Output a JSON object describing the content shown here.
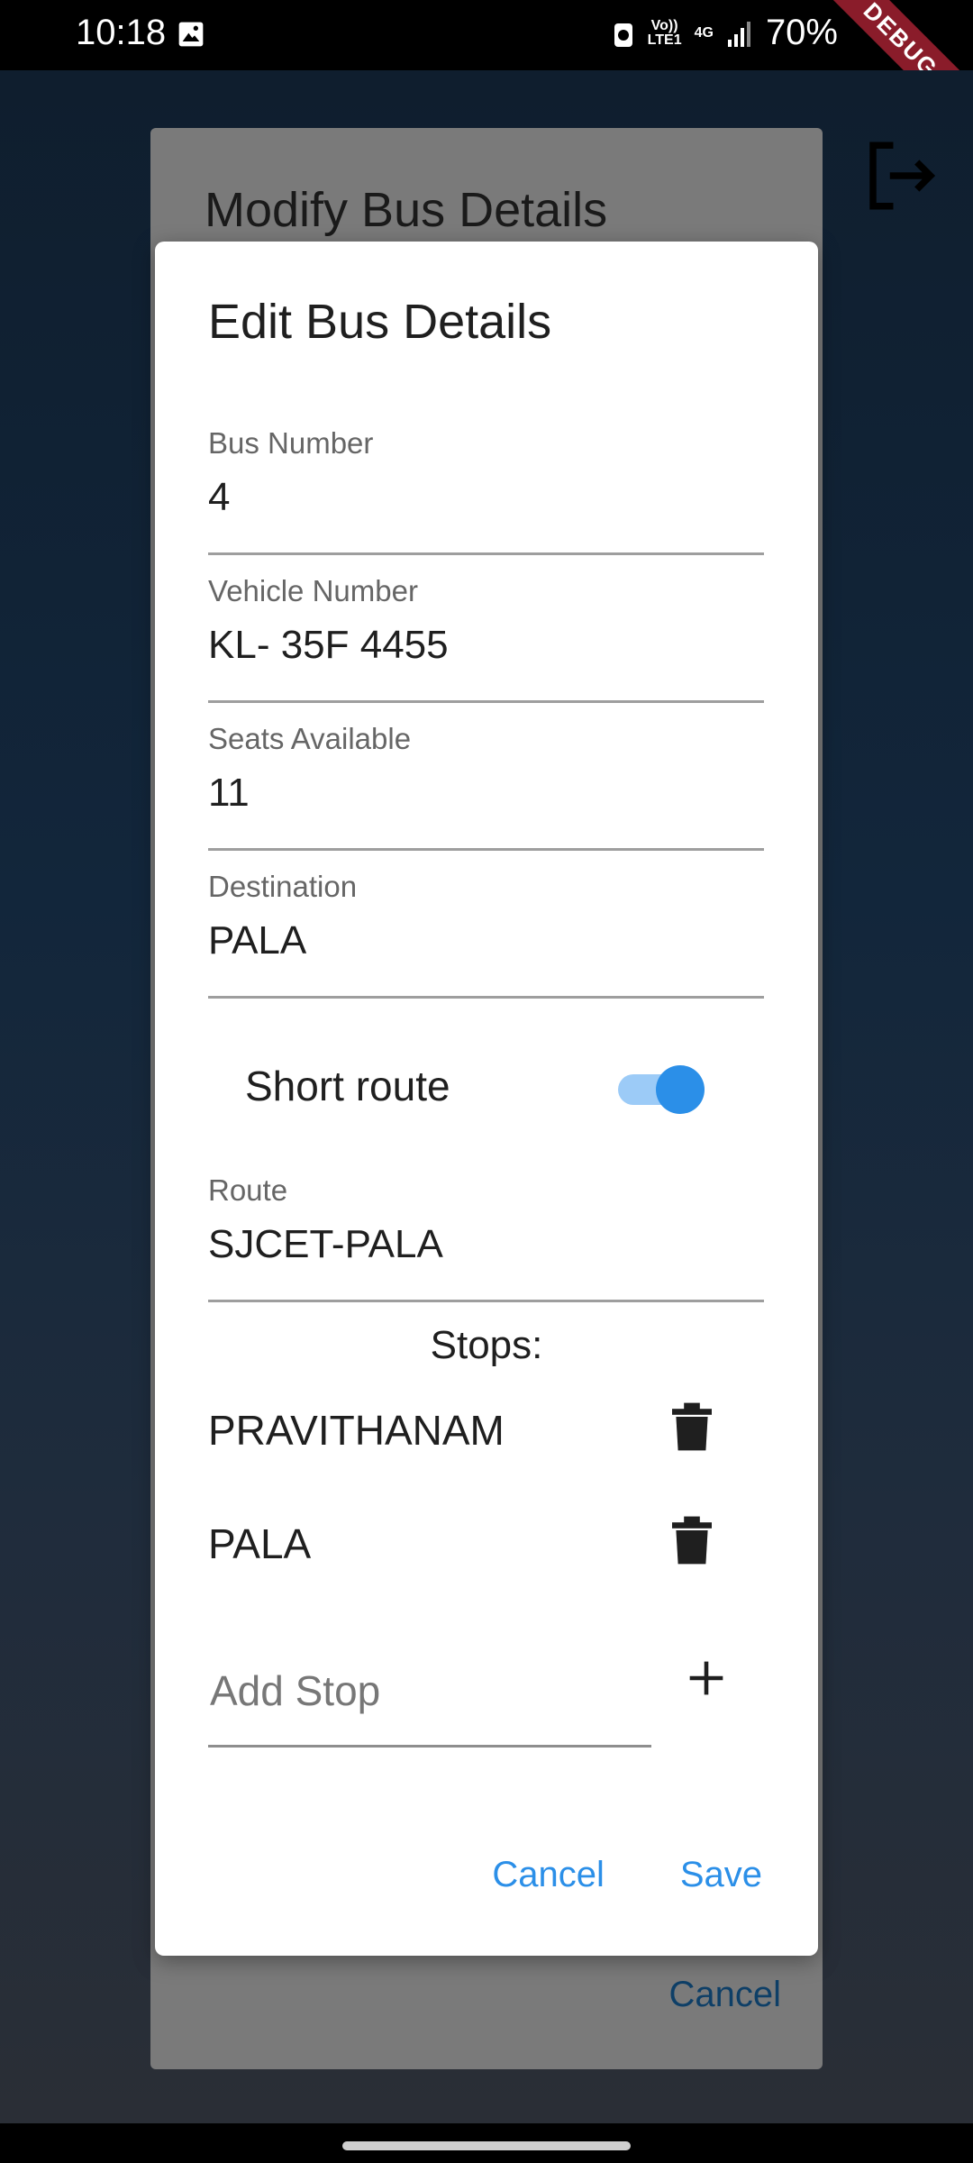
{
  "status_bar": {
    "time": "10:18",
    "volte_line1": "Vo))",
    "volte_line2": "LTE1",
    "network": "4G",
    "battery": "70%",
    "debug_label": "DEBUG"
  },
  "background": {
    "outer_dialog_title": "Modify Bus Details",
    "outer_cancel_label": "Cancel"
  },
  "dialog": {
    "title": "Edit Bus Details",
    "fields": [
      {
        "label": "Bus Number",
        "value": "4"
      },
      {
        "label": "Vehicle Number",
        "value": "KL- 35F 4455"
      },
      {
        "label": "Seats Available",
        "value": "11"
      },
      {
        "label": "Destination",
        "value": "PALA"
      }
    ],
    "short_route": {
      "label": "Short route",
      "enabled": true
    },
    "route": {
      "label": "Route",
      "value": "SJCET-PALA"
    },
    "stops_title": "Stops:",
    "stops": [
      {
        "name": "PRAVITHANAM"
      },
      {
        "name": "PALA"
      }
    ],
    "add_stop_placeholder": "Add Stop",
    "cancel_label": "Cancel",
    "save_label": "Save"
  },
  "colors": {
    "accent": "#2b8fe8",
    "switch_track": "#9ccbf7",
    "debug_banner": "#8a1c2a"
  }
}
